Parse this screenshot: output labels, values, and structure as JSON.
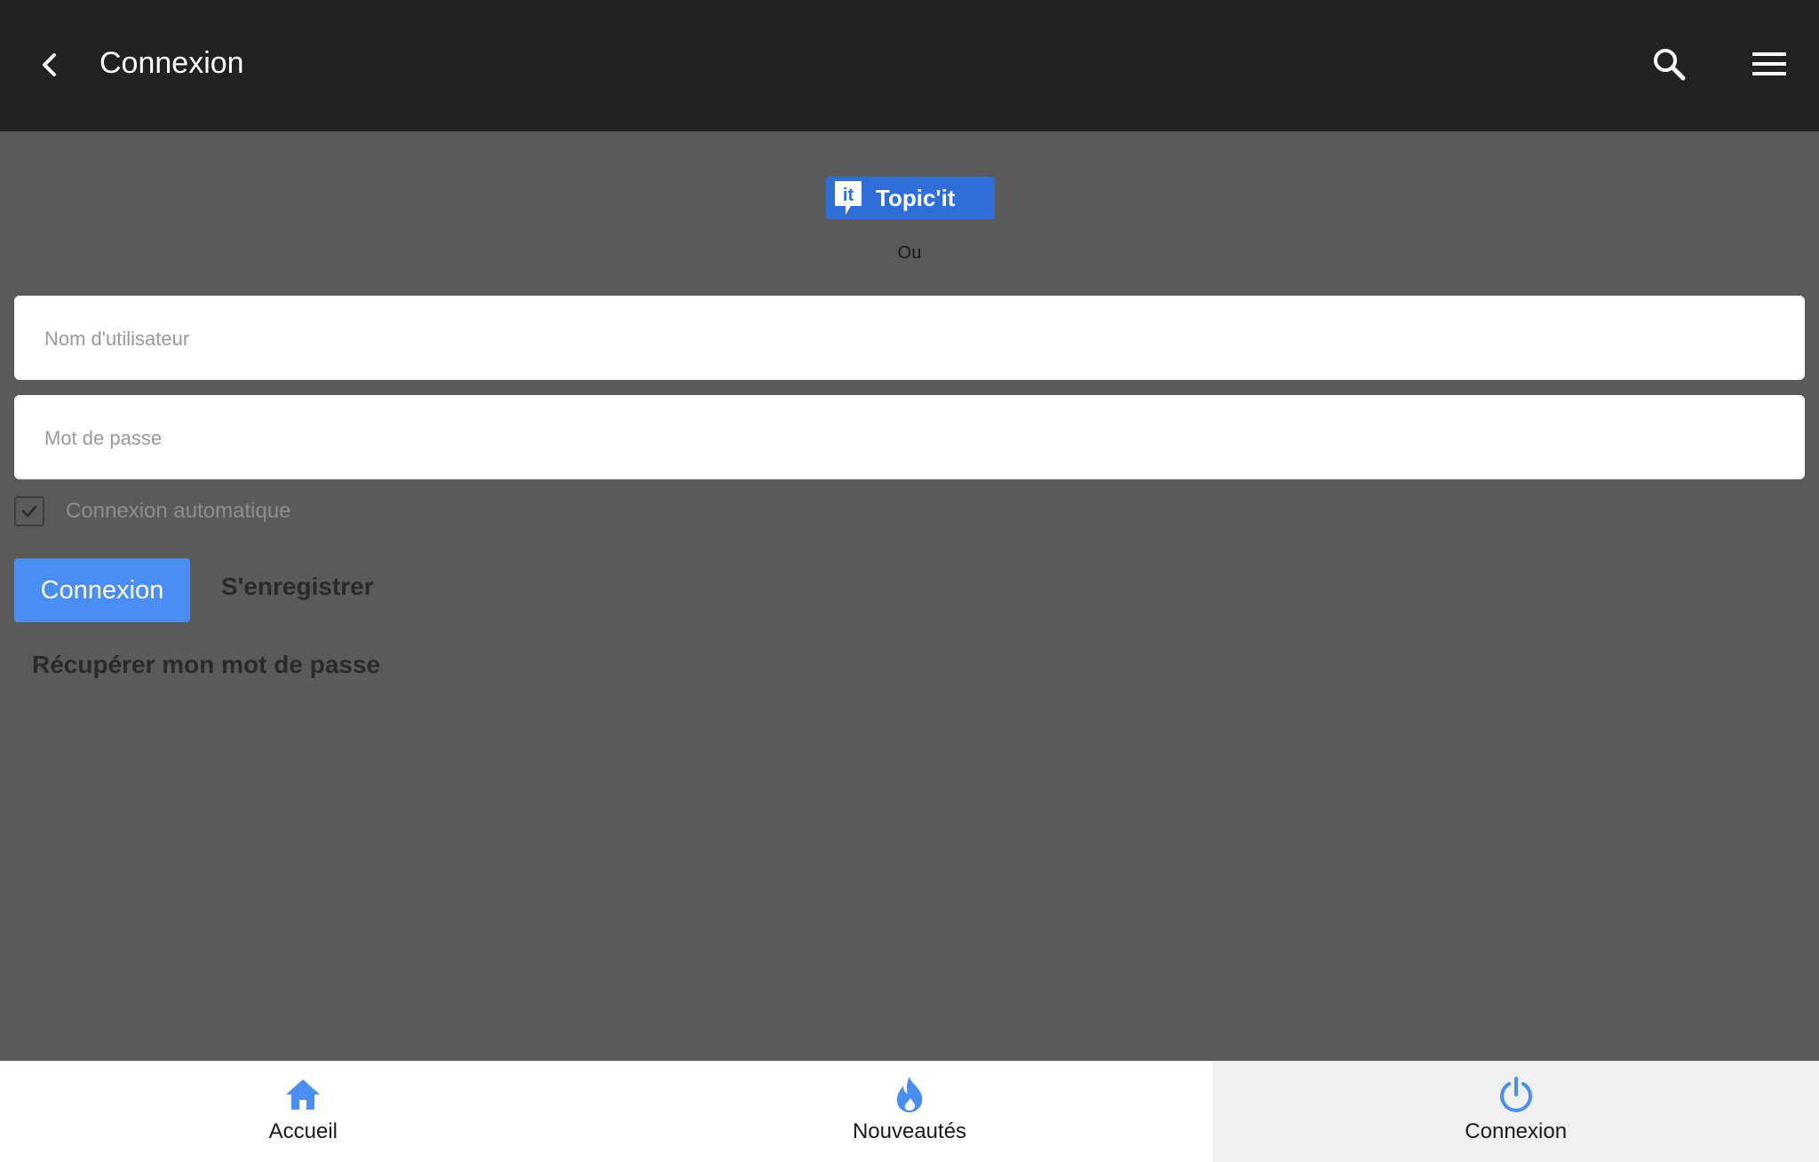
{
  "header": {
    "title": "Connexion",
    "back_icon": "chevron-left-icon",
    "search_icon": "search-icon",
    "menu_icon": "hamburger-menu-icon"
  },
  "social_login": {
    "label": "Topic'it",
    "logo_text": "it",
    "color": "#2f6ed8"
  },
  "separator": "Ou",
  "form": {
    "username_placeholder": "Nom d'utilisateur",
    "password_placeholder": "Mot de passe",
    "auto_login_label": "Connexion automatique",
    "auto_login_checked": true,
    "submit_label": "Connexion",
    "register_label": "S'enregistrer",
    "recover_label": "Récupérer mon mot de passe"
  },
  "bottom_nav": {
    "items": [
      {
        "label": "Accueil",
        "icon": "home-icon",
        "active": false
      },
      {
        "label": "Nouveautés",
        "icon": "flame-icon",
        "active": false
      },
      {
        "label": "Connexion",
        "icon": "power-icon",
        "active": true
      }
    ]
  },
  "colors": {
    "top_bar": "#222222",
    "background": "#5b5a5b",
    "accent": "#4b8ef3"
  }
}
